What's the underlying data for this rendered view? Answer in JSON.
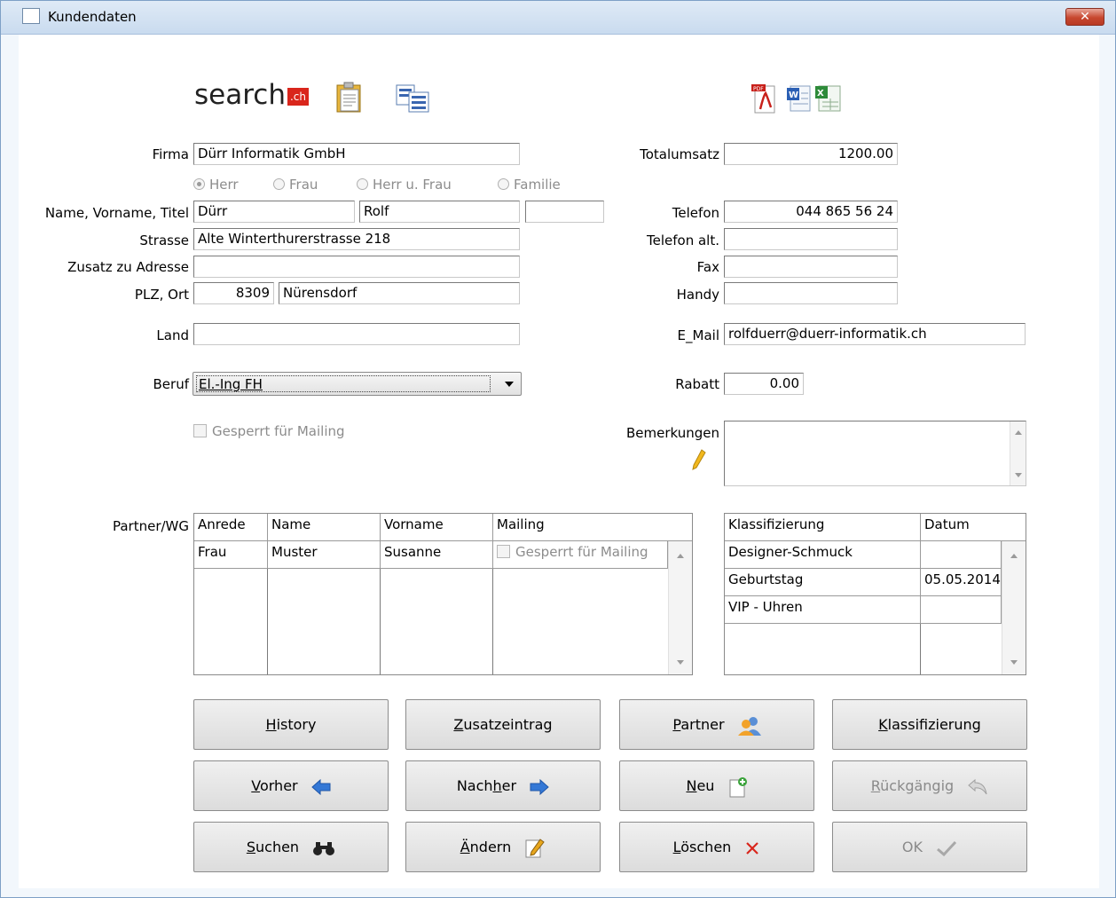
{
  "window": {
    "title": "Kundendaten",
    "close_glyph": "✕"
  },
  "header": {
    "search_logo_text": "search",
    "search_logo_suffix": ".ch"
  },
  "form": {
    "firma": {
      "label": "Firma",
      "value": "Dürr Informatik GmbH"
    },
    "anrede_options": [
      {
        "label": "Herr",
        "selected": true
      },
      {
        "label": "Frau",
        "selected": false
      },
      {
        "label": "Herr u. Frau",
        "selected": false
      },
      {
        "label": "Familie",
        "selected": false
      }
    ],
    "name": {
      "label": "Name, Vorname, Titel",
      "name": "Dürr",
      "vorname": "Rolf",
      "titel": ""
    },
    "strasse": {
      "label": "Strasse",
      "value": "Alte Winterthurerstrasse 218"
    },
    "zusatz": {
      "label": "Zusatz zu Adresse",
      "value": ""
    },
    "plz_ort": {
      "label": "PLZ, Ort",
      "plz": "8309",
      "ort": "Nürensdorf"
    },
    "land": {
      "label": "Land",
      "value": ""
    },
    "beruf": {
      "label": "Beruf",
      "value": "El.-Ing FH"
    },
    "gesperrt": {
      "label": "Gesperrt für Mailing"
    },
    "totalumsatz": {
      "label": "Totalumsatz",
      "value": "1200.00"
    },
    "telefon": {
      "label": "Telefon",
      "value": "044 865 56 24"
    },
    "telefon_alt": {
      "label": "Telefon alt.",
      "value": ""
    },
    "fax": {
      "label": "Fax",
      "value": ""
    },
    "handy": {
      "label": "Handy",
      "value": ""
    },
    "email": {
      "label": "E_Mail",
      "value": "rolfduerr@duerr-informatik.ch"
    },
    "rabatt": {
      "label": "Rabatt",
      "value": "0.00"
    },
    "bemerkungen": {
      "label": "Bemerkungen",
      "value": ""
    }
  },
  "partner": {
    "label": "Partner/WG",
    "columns": [
      "Anrede",
      "Name",
      "Vorname",
      "Mailing"
    ],
    "rows": [
      {
        "anrede": "Frau",
        "name": "Muster",
        "vorname": "Susanne",
        "mailing": "Gesperrt für Mailing"
      }
    ]
  },
  "klassifizierung": {
    "columns": [
      "Klassifizierung",
      "Datum"
    ],
    "rows": [
      {
        "name": "Designer-Schmuck",
        "datum": ""
      },
      {
        "name": "Geburtstag",
        "datum": "05.05.2014"
      },
      {
        "name": "VIP - Uhren",
        "datum": ""
      }
    ]
  },
  "buttons": {
    "history": {
      "u": "H",
      "rest": "istory"
    },
    "zusatzeintrag": {
      "u": "Z",
      "rest": "usatzeintrag"
    },
    "partner": {
      "u": "P",
      "rest": "artner"
    },
    "klassifizierung": {
      "u": "K",
      "rest": "lassifizierung"
    },
    "vorher": {
      "u": "V",
      "rest": "orher"
    },
    "nachher": {
      "pre": "Nach",
      "u": "h",
      "rest": "er"
    },
    "neu": {
      "u": "N",
      "rest": "eu"
    },
    "rueckgaengig": {
      "u": "R",
      "rest": "ückgängig"
    },
    "suchen": {
      "u": "S",
      "rest": "uchen"
    },
    "aendern": {
      "u": "Ä",
      "rest": "ndern"
    },
    "loeschen": {
      "u": "L",
      "rest": "öschen"
    },
    "ok": {
      "label": "OK"
    }
  },
  "colors": {
    "accent_red": "#d9261c",
    "title_bg": "#dfeaf6",
    "window_border": "#7ea0c6"
  }
}
